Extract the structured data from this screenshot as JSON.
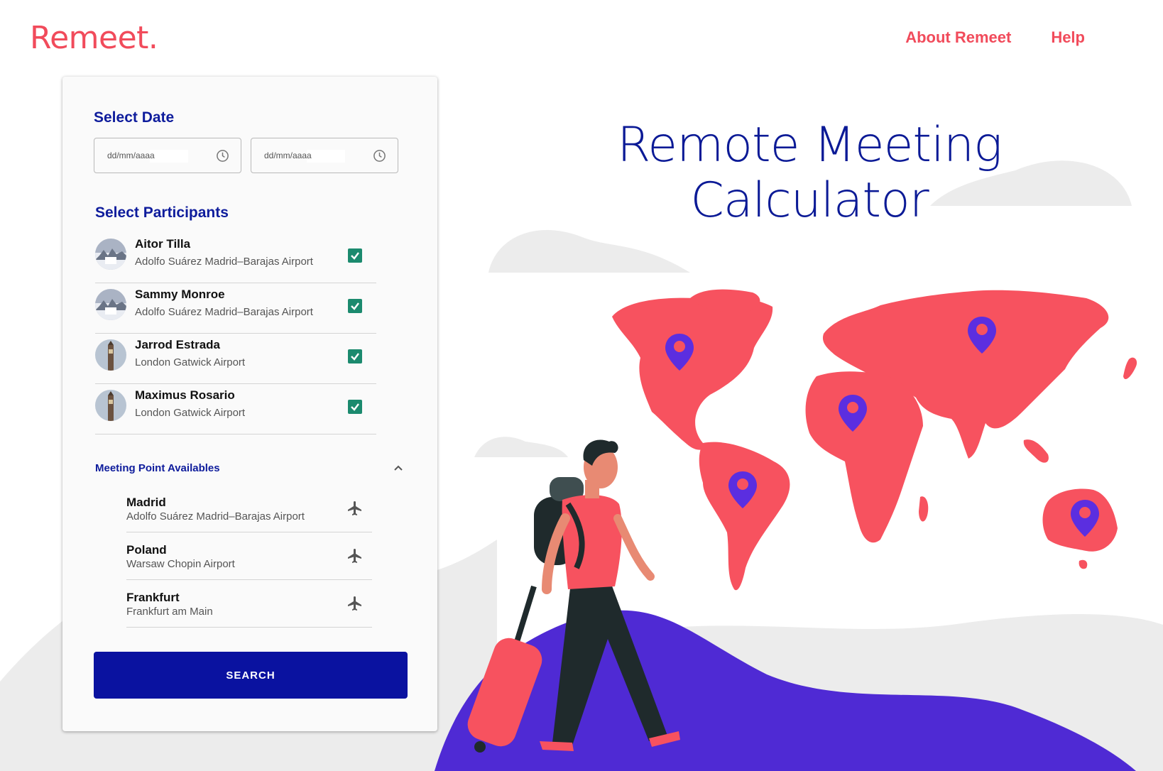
{
  "brand": {
    "logo": "Remeet.",
    "color": "#f14b5b"
  },
  "nav": {
    "about": "About Remeet",
    "help": "Help"
  },
  "hero": {
    "line1": "Remote Meeting",
    "line2": "Calculator"
  },
  "form": {
    "date_title": "Select Date",
    "date_from": {
      "placeholder": "dd/mm/aaaa"
    },
    "date_to": {
      "placeholder": "dd/mm/aaaa"
    },
    "participants_title": "Select Participants",
    "participants": [
      {
        "name": "Aitor Tilla",
        "airport": "Adolfo Suárez Madrid–Barajas Airport",
        "checked": true,
        "avatar": "madrid-photo"
      },
      {
        "name": "Sammy Monroe",
        "airport": "Adolfo Suárez Madrid–Barajas Airport",
        "checked": true,
        "avatar": "madrid-photo"
      },
      {
        "name": "Jarrod Estrada",
        "airport": "London Gatwick Airport",
        "checked": true,
        "avatar": "london-photo"
      },
      {
        "name": "Maximus Rosario",
        "airport": "London Gatwick Airport",
        "checked": true,
        "avatar": "london-photo"
      }
    ],
    "meeting_points_title": "Meeting Point Availables",
    "meeting_points": [
      {
        "city": "Madrid",
        "airport": "Adolfo Suárez Madrid–Barajas Airport"
      },
      {
        "city": "Poland",
        "airport": "Warsaw Chopin Airport"
      },
      {
        "city": "Frankfurt",
        "airport": "Frankfurt am Main"
      }
    ],
    "search_label": "SEARCH"
  },
  "colors": {
    "primary": "#0a12a0",
    "accent": "#f14b5b",
    "check": "#1b8a6e",
    "hill": "#4f2ad4",
    "pin": "#5b2ee0"
  }
}
